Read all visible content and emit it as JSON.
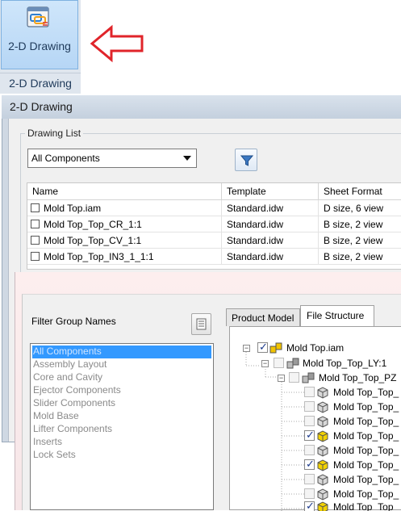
{
  "ribbon": {
    "button_label": "2-D Drawing",
    "group_label": "2-D Drawing"
  },
  "dialog": {
    "title": "2-D Drawing",
    "drawing_list_label": "Drawing List",
    "filter_combo_value": "All Components",
    "table": {
      "columns": [
        "Name",
        "Template",
        "Sheet Format"
      ],
      "rows": [
        {
          "name": "Mold Top.iam",
          "template": "Standard.idw",
          "sheet_format": "D size, 6 view"
        },
        {
          "name": "Mold Top_Top_CR_1:1",
          "template": "Standard.idw",
          "sheet_format": "B size, 2 view"
        },
        {
          "name": "Mold Top_Top_CV_1:1",
          "template": "Standard.idw",
          "sheet_format": "B size, 2 view"
        },
        {
          "name": "Mold Top_Top_IN3_1_1:1",
          "template": "Standard.idw",
          "sheet_format": "B size, 2 view"
        }
      ]
    }
  },
  "filter_dialog": {
    "group_names_label": "Filter Group Names",
    "group_names": [
      "All Components",
      "Assembly Layout",
      "Core and Cavity",
      "Ejector Components",
      "Slider Components",
      "Mold Base",
      "Lifter Components",
      "Inserts",
      "Lock Sets"
    ],
    "selected_group": "All Components",
    "tabs": [
      "Product Model",
      "File Structure"
    ],
    "active_tab": "File Structure",
    "tree": {
      "root": "Mold Top.iam",
      "level1": "Mold Top_Top_LY:1",
      "level2": "Mold Top_Top_PZ",
      "leaves": [
        {
          "label": "Mold Top_Top_",
          "checked": false
        },
        {
          "label": "Mold Top_Top_",
          "checked": false
        },
        {
          "label": "Mold Top_Top_",
          "checked": false
        },
        {
          "label": "Mold Top_Top_",
          "checked": true
        },
        {
          "label": "Mold Top_Top_",
          "checked": false
        },
        {
          "label": "Mold Top_Top_",
          "checked": true
        },
        {
          "label": "Mold Top_Top_",
          "checked": false
        },
        {
          "label": "Mold Top_Top_",
          "checked": false
        },
        {
          "label": "Mold Top_Top_",
          "checked": true
        }
      ]
    }
  },
  "colors": {
    "selection": "#3399ff",
    "arrow": "#e0242a"
  }
}
